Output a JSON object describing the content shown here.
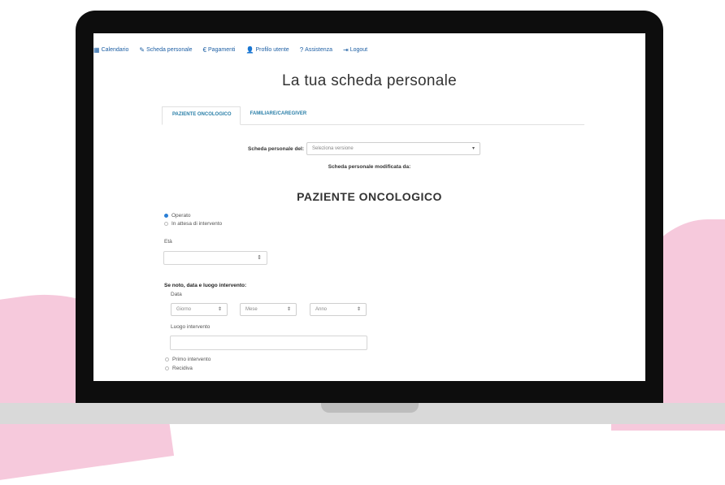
{
  "nav": {
    "items": [
      {
        "label": "Calendario",
        "icon": "calendar-icon",
        "glyph": "▦"
      },
      {
        "label": "Scheda personale",
        "icon": "pencil-icon",
        "glyph": "✎"
      },
      {
        "label": "Pagamenti",
        "icon": "euro-icon",
        "glyph": "€"
      },
      {
        "label": "Profilo utente",
        "icon": "user-icon",
        "glyph": "👤"
      },
      {
        "label": "Assistenza",
        "icon": "question-icon",
        "glyph": "?"
      },
      {
        "label": "Logout",
        "icon": "logout-icon",
        "glyph": "⇥"
      }
    ]
  },
  "page_title": "La tua scheda personale",
  "tabs": [
    {
      "label": "PAZIENTE ONCOLOGICO",
      "active": true
    },
    {
      "label": "FAMILIARE/CAREGIVER",
      "active": false
    }
  ],
  "version": {
    "label": "Scheda personale del:",
    "placeholder": "Seleziona versione"
  },
  "modified_by": "Scheda personale modificata da:",
  "section_title": "PAZIENTE ONCOLOGICO",
  "status_options": [
    {
      "label": "Operato",
      "selected": true
    },
    {
      "label": "In attesa di intervento",
      "selected": false
    }
  ],
  "age_label": "Età",
  "surgery_heading": "Se noto, data e luogo intervento:",
  "date_label": "Data",
  "date_selects": {
    "day": "Giorno",
    "month": "Mese",
    "year": "Anno"
  },
  "place_label": "Luogo intervento",
  "intervention_type": [
    {
      "label": "Primo intervento",
      "selected": false
    },
    {
      "label": "Recidiva",
      "selected": false
    }
  ],
  "colors": {
    "link": "#1d5fa4",
    "tab": "#2a7fa8",
    "radio_on": "#2a7fd6",
    "pink": "#f6c9dc"
  }
}
